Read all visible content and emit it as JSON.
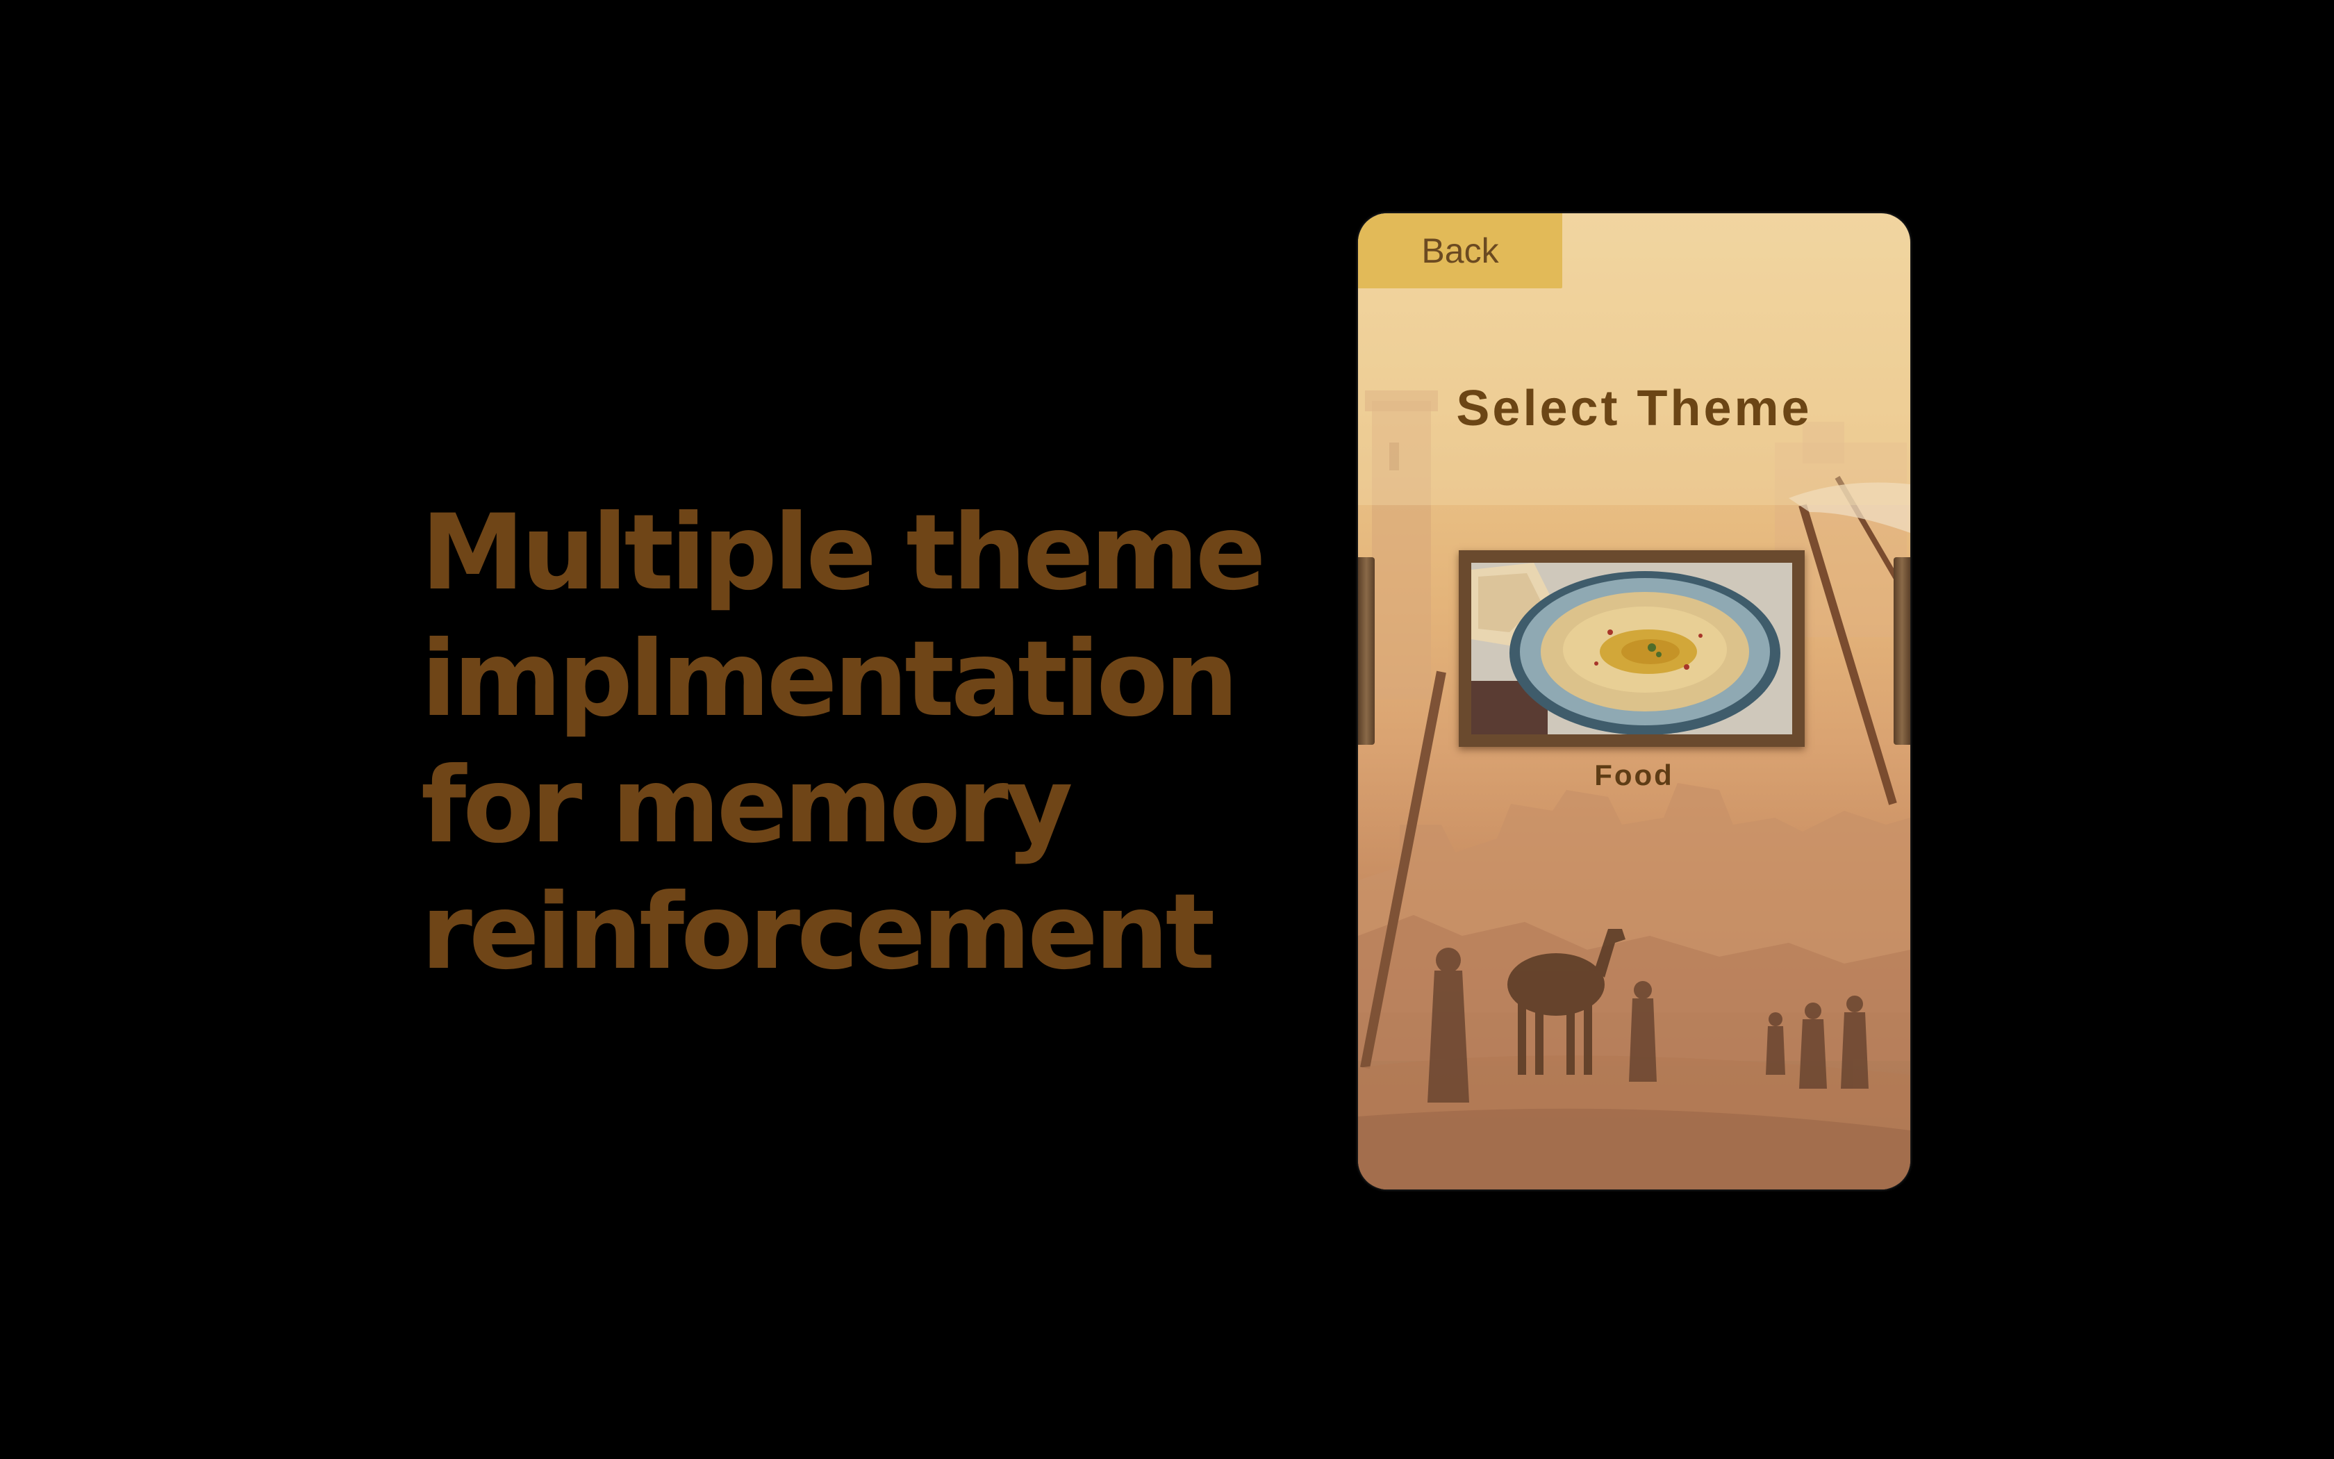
{
  "headline": {
    "lines": [
      "Multiple theme",
      "implmentation",
      "for memory",
      "reinforcement"
    ]
  },
  "app": {
    "back_label": "Back",
    "title": "Select Theme",
    "selected_theme": {
      "label": "Food",
      "thumbnail_icon": "hummus-plate-image"
    }
  },
  "colors": {
    "page_background": "#000000",
    "headline_text": "#6f4517",
    "back_button": "#e2ba58",
    "title_text": "#6b4515",
    "frame": "#6a4a2e"
  }
}
